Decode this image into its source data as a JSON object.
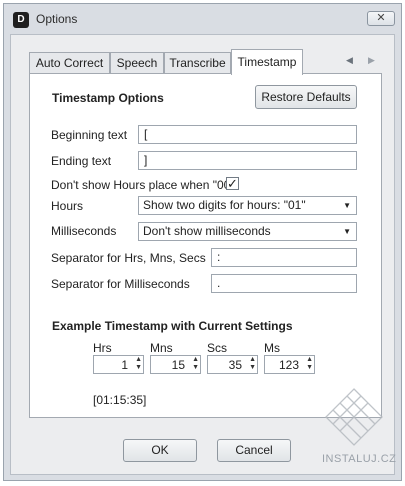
{
  "window": {
    "title": "Options",
    "close_label": "✕",
    "app_icon": "app-icon",
    "app_icon_letter": "D"
  },
  "tabs": [
    {
      "label": "Auto Correct"
    },
    {
      "label": "Speech"
    },
    {
      "label": "Transcribe"
    },
    {
      "label": "Timestamp",
      "active": true
    }
  ],
  "tab_nav": {
    "prev": "◀",
    "next": "▶"
  },
  "options": {
    "heading": "Timestamp Options",
    "restore_label": "Restore Defaults",
    "beginning_label": "Beginning text",
    "beginning_value": "[",
    "ending_label": "Ending text",
    "ending_value": "]",
    "hide_hours_label": "Don't show Hours place when \"00\"",
    "hide_hours_checked": true,
    "hide_hours_mark": "✓",
    "hours_label": "Hours",
    "hours_value": "Show two digits for hours: \"01\"",
    "ms_label": "Milliseconds",
    "ms_value": "Don't show milliseconds",
    "dropdown_arrow": "▼",
    "sep_hms_label": "Separator for Hrs, Mns, Secs",
    "sep_hms_value": ":",
    "sep_ms_label": "Separator for Milliseconds",
    "sep_ms_value": "."
  },
  "example": {
    "heading": "Example Timestamp with Current Settings",
    "spin_up": "▲",
    "spin_down": "▼",
    "fields": [
      {
        "label": "Hrs",
        "value": "1"
      },
      {
        "label": "Mns",
        "value": "15"
      },
      {
        "label": "Scs",
        "value": "35"
      },
      {
        "label": "Ms",
        "value": "123"
      }
    ],
    "result": "[01:15:35]"
  },
  "footer": {
    "ok_label": "OK",
    "cancel_label": "Cancel"
  },
  "watermark": {
    "text": "INSTALUJ.CZ"
  },
  "colors": {
    "window_bg": "#d9dde3",
    "panel_bg": "#ffffff",
    "border": "#a3a9b1"
  }
}
